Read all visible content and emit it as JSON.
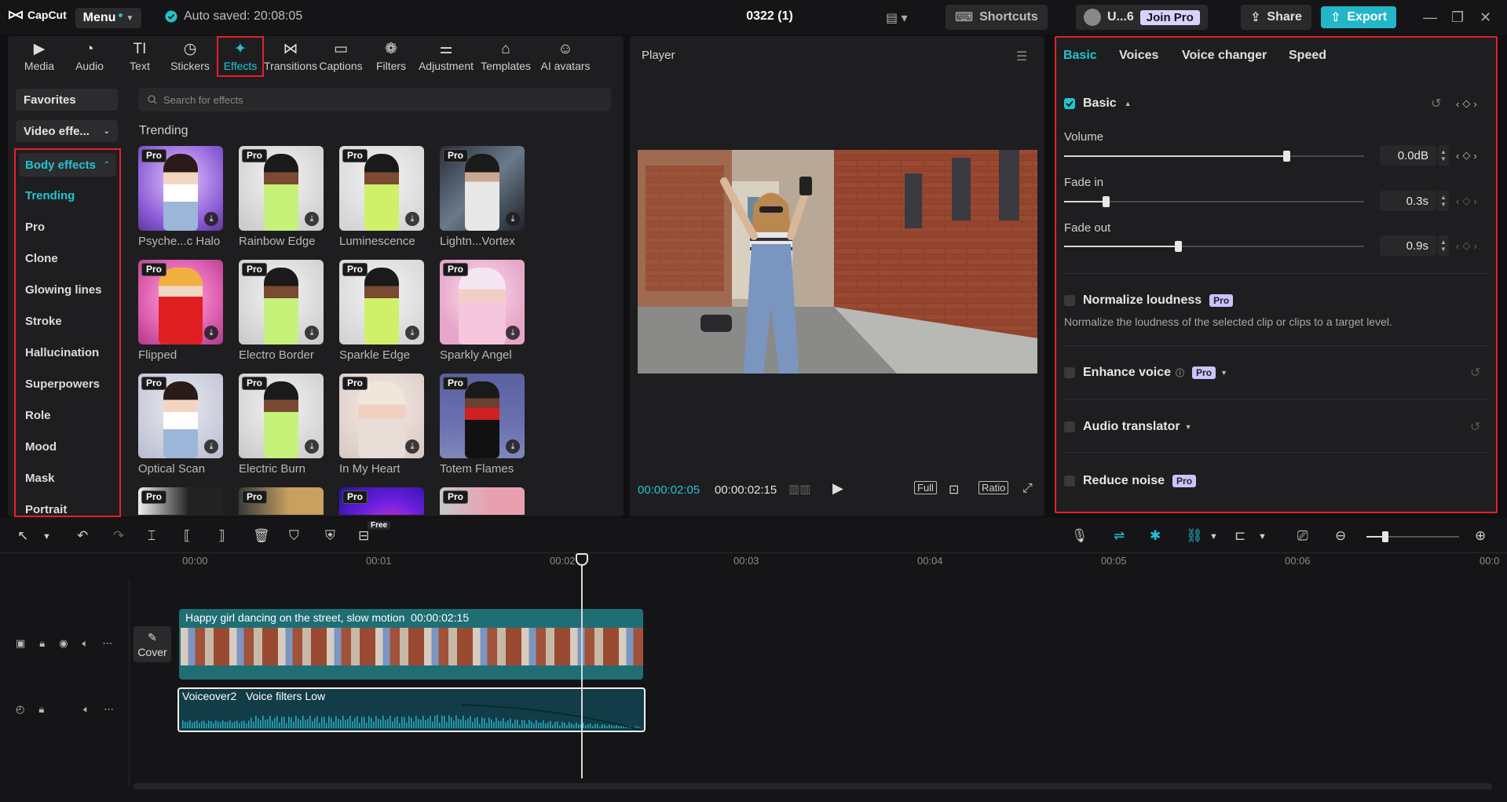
{
  "app": {
    "name": "CapCut",
    "menu_label": "Menu",
    "autosave": "Auto saved: 20:08:05",
    "project_title": "0322 (1)"
  },
  "titlebar": {
    "shortcuts": "Shortcuts",
    "user": "U...6",
    "join_pro": "Join Pro",
    "share": "Share",
    "export": "Export"
  },
  "tool_tabs": [
    {
      "label": "Media",
      "icon": "media-icon"
    },
    {
      "label": "Audio",
      "icon": "audio-icon"
    },
    {
      "label": "Text",
      "icon": "text-icon"
    },
    {
      "label": "Stickers",
      "icon": "stickers-icon"
    },
    {
      "label": "Effects",
      "icon": "effects-icon"
    },
    {
      "label": "Transitions",
      "icon": "transitions-icon"
    },
    {
      "label": "Captions",
      "icon": "captions-icon"
    },
    {
      "label": "Filters",
      "icon": "filters-icon"
    },
    {
      "label": "Adjustment",
      "icon": "adjustment-icon"
    },
    {
      "label": "Templates",
      "icon": "templates-icon"
    },
    {
      "label": "AI avatars",
      "icon": "ai-avatars-icon"
    }
  ],
  "effects_panel": {
    "favorites": "Favorites",
    "video_effects": "Video effe...",
    "body_effects": "Body effects",
    "categories": [
      "Trending",
      "Pro",
      "Clone",
      "Glowing lines",
      "Stroke",
      "Hallucination",
      "Superpowers",
      "Role",
      "Mood",
      "Mask",
      "Portrait"
    ],
    "search_placeholder": "Search for effects",
    "section_title": "Trending",
    "pro_label": "Pro",
    "items": [
      "Psyche...c Halo",
      "Rainbow Edge",
      "Luminescence",
      "Lightn...Vortex",
      "Flipped",
      "Electro Border",
      "Sparkle Edge",
      "Sparkly Angel",
      "Optical Scan",
      "Electric Burn",
      "In My Heart",
      "Totem Flames"
    ]
  },
  "player": {
    "title": "Player",
    "current_time": "00:00:02:05",
    "duration": "00:00:02:15",
    "full_label": "Full",
    "ratio_label": "Ratio"
  },
  "right_panel": {
    "tabs": [
      "Basic",
      "Voices",
      "Voice changer",
      "Speed"
    ],
    "basic_label": "Basic",
    "volume": {
      "label": "Volume",
      "value": "0.0dB",
      "position": 0.74
    },
    "fade_in": {
      "label": "Fade in",
      "value": "0.3s",
      "position": 0.14
    },
    "fade_out": {
      "label": "Fade out",
      "value": "0.9s",
      "position": 0.38
    },
    "normalize": {
      "label": "Normalize loudness",
      "desc": "Normalize the loudness of the selected clip or clips to a target level."
    },
    "enhance_voice": "Enhance voice",
    "audio_translator": "Audio translator",
    "reduce_noise": "Reduce noise",
    "pro_label": "Pro"
  },
  "timeline": {
    "free_badge": "Free",
    "ruler": [
      "00:00",
      "00:01",
      "00:02",
      "00:03",
      "00:04",
      "00:05",
      "00:06",
      "00:0"
    ],
    "cover_label": "Cover",
    "video_clip": {
      "title": "Happy girl dancing on the street, slow motion",
      "duration": "00:00:02:15"
    },
    "audio_clip": {
      "name": "Voiceover2",
      "filter": "Voice filters Low"
    }
  }
}
